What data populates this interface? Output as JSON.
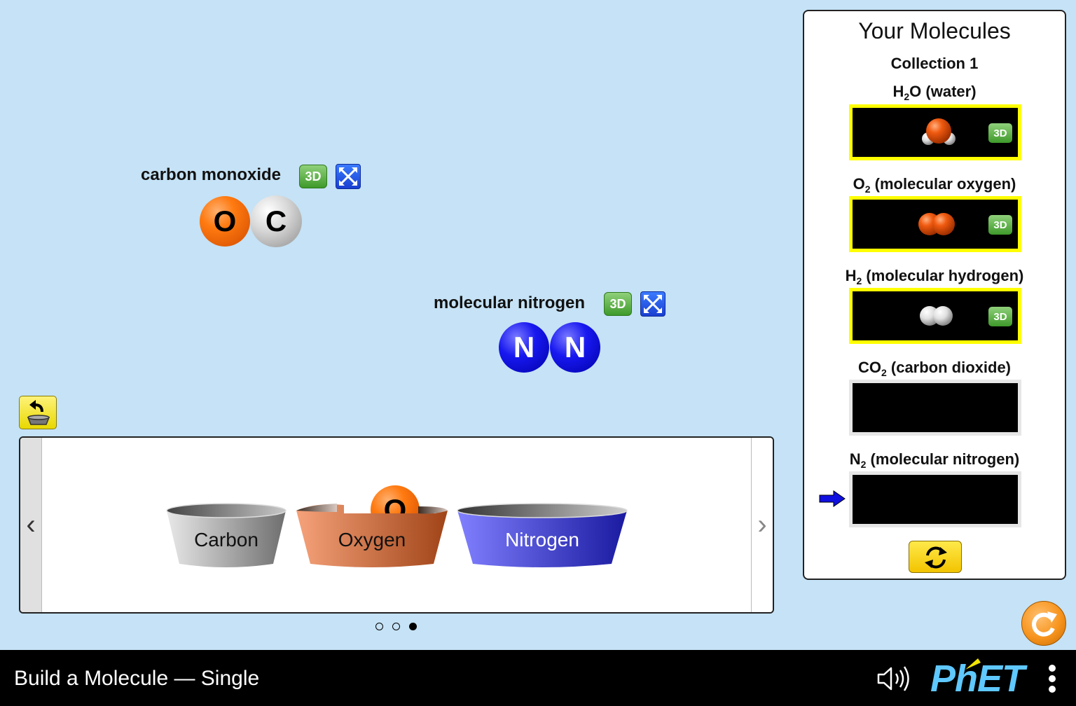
{
  "play_area": {
    "molecules": [
      {
        "name": "carbon monoxide",
        "btn_3d": "3D",
        "atoms": [
          "O",
          "C"
        ]
      },
      {
        "name": "molecular nitrogen",
        "btn_3d": "3D",
        "atoms": [
          "N",
          "N"
        ]
      }
    ]
  },
  "kit": {
    "buckets": [
      {
        "label": "Carbon",
        "color": "#9a9a9a"
      },
      {
        "label": "Oxygen",
        "color": "#e07a45"
      },
      {
        "label": "Nitrogen",
        "color": "#4a4ae0"
      }
    ],
    "bucket_atom": "O",
    "prev_glyph": "‹",
    "next_glyph": "›",
    "page_count": 3,
    "current_page": 3
  },
  "collection": {
    "title": "Your Molecules",
    "subtitle": "Collection 1",
    "slots": [
      {
        "formula": "H",
        "sub": "2",
        "formula_rest": "O",
        "name": " (water)",
        "filled": true,
        "btn_3d": "3D"
      },
      {
        "formula": "O",
        "sub": "2",
        "formula_rest": "",
        "name": " (molecular oxygen)",
        "filled": true,
        "btn_3d": "3D"
      },
      {
        "formula": "H",
        "sub": "2",
        "formula_rest": "",
        "name": " (molecular hydrogen)",
        "filled": true,
        "btn_3d": "3D"
      },
      {
        "formula": "CO",
        "sub": "2",
        "formula_rest": "",
        "name": " (carbon dioxide)",
        "filled": false
      },
      {
        "formula": "N",
        "sub": "2",
        "formula_rest": "",
        "name": " (molecular nitrogen)",
        "filled": false
      }
    ]
  },
  "navbar": {
    "title": "Build a Molecule — Single",
    "brand": "PhET"
  },
  "colors": {
    "background": "#c5e2f6",
    "slot_highlight": "#ffff00",
    "reset_button": "#f7941d",
    "yellow_button": "#f5d800"
  },
  "icons": [
    "return-atoms-icon",
    "break-apart-icon",
    "refresh-icon",
    "reset-all-icon",
    "sound-icon",
    "menu-icon",
    "arrow-right-icon"
  ]
}
